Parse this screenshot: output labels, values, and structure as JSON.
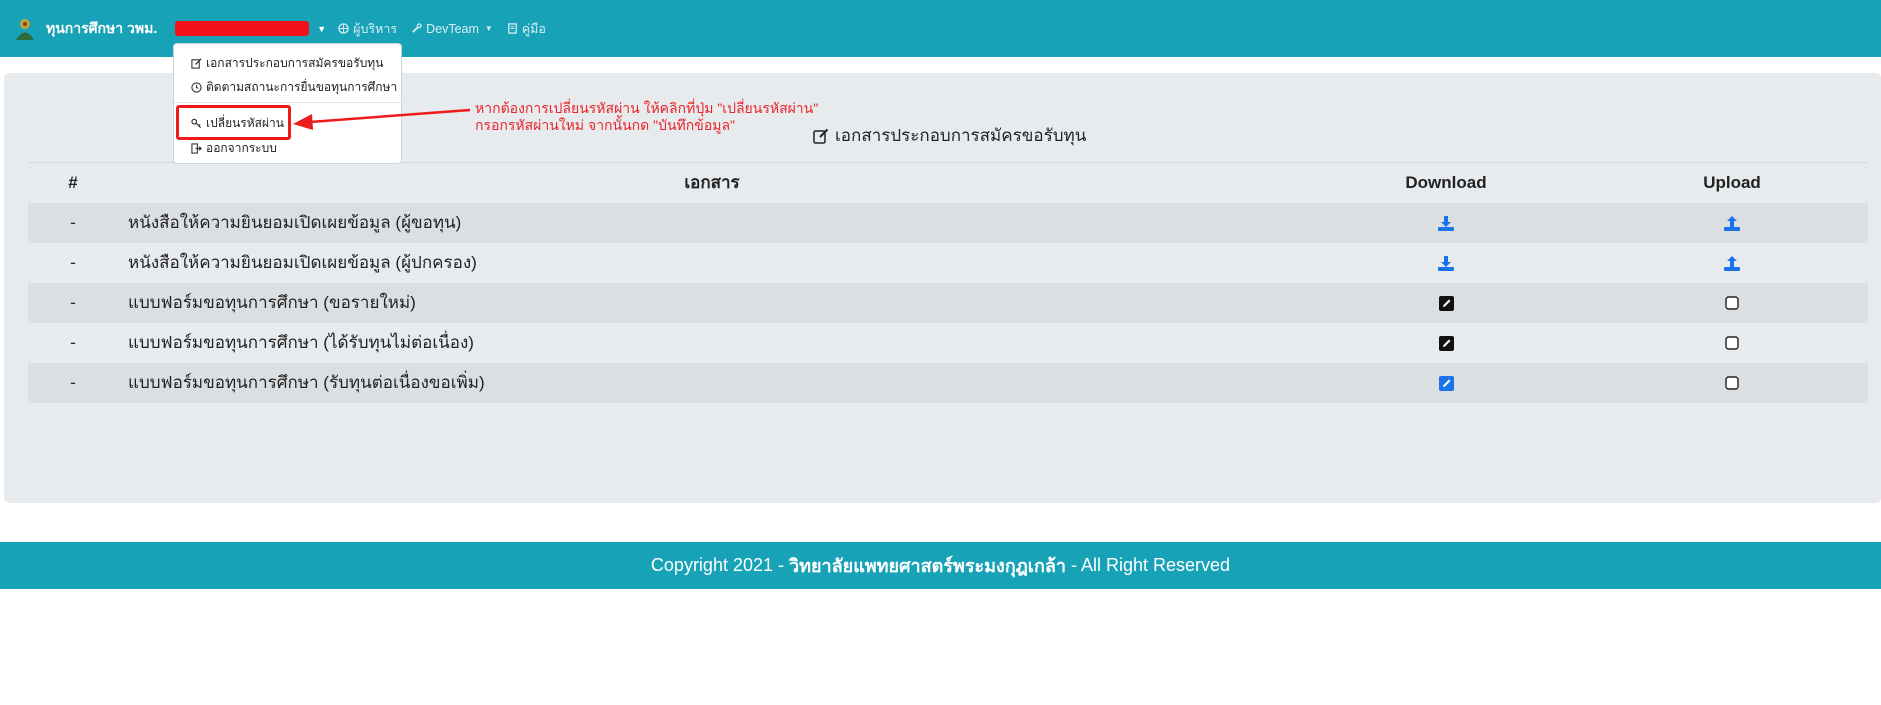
{
  "navbar": {
    "brand": "ทุนการศึกษา วพม.",
    "links": [
      {
        "label": "ผู้บริหาร",
        "icon": "globe-icon"
      },
      {
        "label": "DevTeam",
        "icon": "wrench-icon"
      },
      {
        "label": "คู่มือ",
        "icon": "book-icon"
      }
    ]
  },
  "dropdown": {
    "items": [
      {
        "label": "เอกสารประกอบการสมัครขอรับทุน",
        "icon": "edit-icon"
      },
      {
        "label": "ติดตามสถานะการยื่นขอทุนการศึกษา",
        "icon": "clock-icon"
      },
      {
        "label": "เปลี่ยนรหัสผ่าน",
        "icon": "key-icon"
      },
      {
        "label": "ออกจากระบบ",
        "icon": "sign-out-icon"
      }
    ]
  },
  "annotation": {
    "line1": "หากต้องการเปลี่ยนรหัสผ่าน ให้คลิกที่ปุ่ม \"เปลี่ยนรหัสผ่าน\"",
    "line2": "กรอกรหัสผ่านใหม่ จากนั้นกด \"บันทึกข้อมูล\""
  },
  "main": {
    "title": "เอกสารประกอบการสมัครขอรับทุน",
    "table": {
      "headers": [
        "#",
        "เอกสาร",
        "Download",
        "Upload"
      ],
      "rows": [
        {
          "num": "-",
          "document": "หนังสือให้ความยินยอมเปิดเผยข้อมูล (ผู้ขอทุน)",
          "download": "download-icon",
          "upload": "upload-icon"
        },
        {
          "num": "-",
          "document": "หนังสือให้ความยินยอมเปิดเผยข้อมูล (ผู้ปกครอง)",
          "download": "download-icon",
          "upload": "upload-icon"
        },
        {
          "num": "-",
          "document": "แบบฟอร์มขอทุนการศึกษา (ขอรายใหม่)",
          "download": "pencil-square-icon",
          "upload": "checkbox"
        },
        {
          "num": "-",
          "document": "แบบฟอร์มขอทุนการศึกษา (ได้รับทุนไม่ต่อเนื่อง)",
          "download": "pencil-square-icon",
          "upload": "checkbox"
        },
        {
          "num": "-",
          "document": "แบบฟอร์มขอทุนการศึกษา (รับทุนต่อเนื่องขอเพิ่ม)",
          "download": "pencil-square-icon",
          "upload": "checkbox"
        }
      ]
    }
  },
  "footer": {
    "prefix": "Copyright 2021 -",
    "org": "วิทยาลัยแพทยศาสตร์พระมงกุฎเกล้า",
    "suffix": "- All Right Reserved"
  },
  "colors": {
    "navbar": "#17a2b8",
    "annotation": "#e8262a",
    "icon_blue": "#1a73e8",
    "icon_dark": "#111111"
  }
}
